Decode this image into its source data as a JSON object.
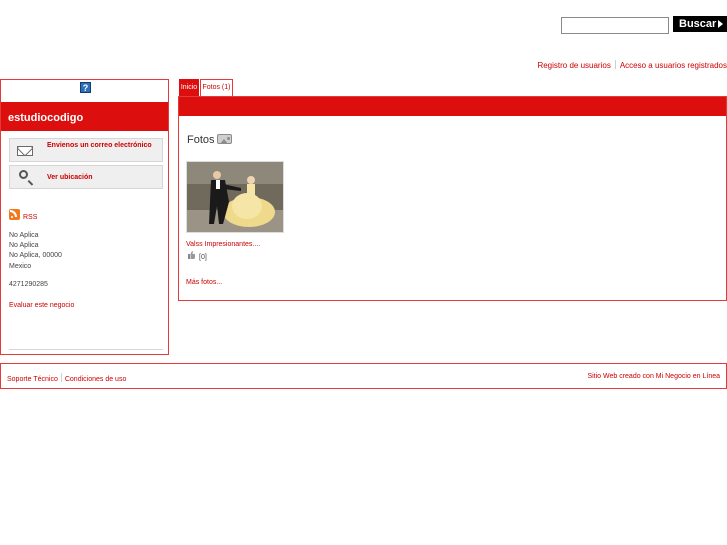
{
  "search": {
    "placeholder": "",
    "value": "",
    "button_label": "Buscar",
    "icon": "arrow-right-icon"
  },
  "top_links": {
    "register": "Registro de usuarios",
    "login": "Acceso a usuarios registrados"
  },
  "sidebar": {
    "help_icon": "help-icon",
    "help_glyph": "?",
    "business_name": "estudiocodigo",
    "actions": [
      {
        "label": "Envienos un correo electrónico",
        "icon": "mail-icon"
      },
      {
        "label": "Ver ubicación",
        "icon": "magnifier-icon"
      }
    ],
    "rss_label": "RSS",
    "address": [
      "No Aplica",
      "No Aplica",
      "No Aplica, 00000",
      "Mexico"
    ],
    "phone": "4271290285",
    "evaluate_link": "Evaluar este negocio"
  },
  "tabs": [
    {
      "label": "Inicio",
      "active": true
    },
    {
      "label": "Fotos (1)",
      "active": false
    }
  ],
  "photos": {
    "section_title": "Fotos",
    "items": [
      {
        "title": "Valss Impresionantes....",
        "votes": "[0]"
      }
    ],
    "more_link": "Más fotos..."
  },
  "footer": {
    "support": "Soporte Técnico",
    "terms": "Condiciones de uso",
    "credit": "Sitio Web creado con Mi Negocio en Línea"
  },
  "colors": {
    "accent": "#dd0e0e",
    "link": "#cc0000",
    "border": "#e23b3b"
  }
}
